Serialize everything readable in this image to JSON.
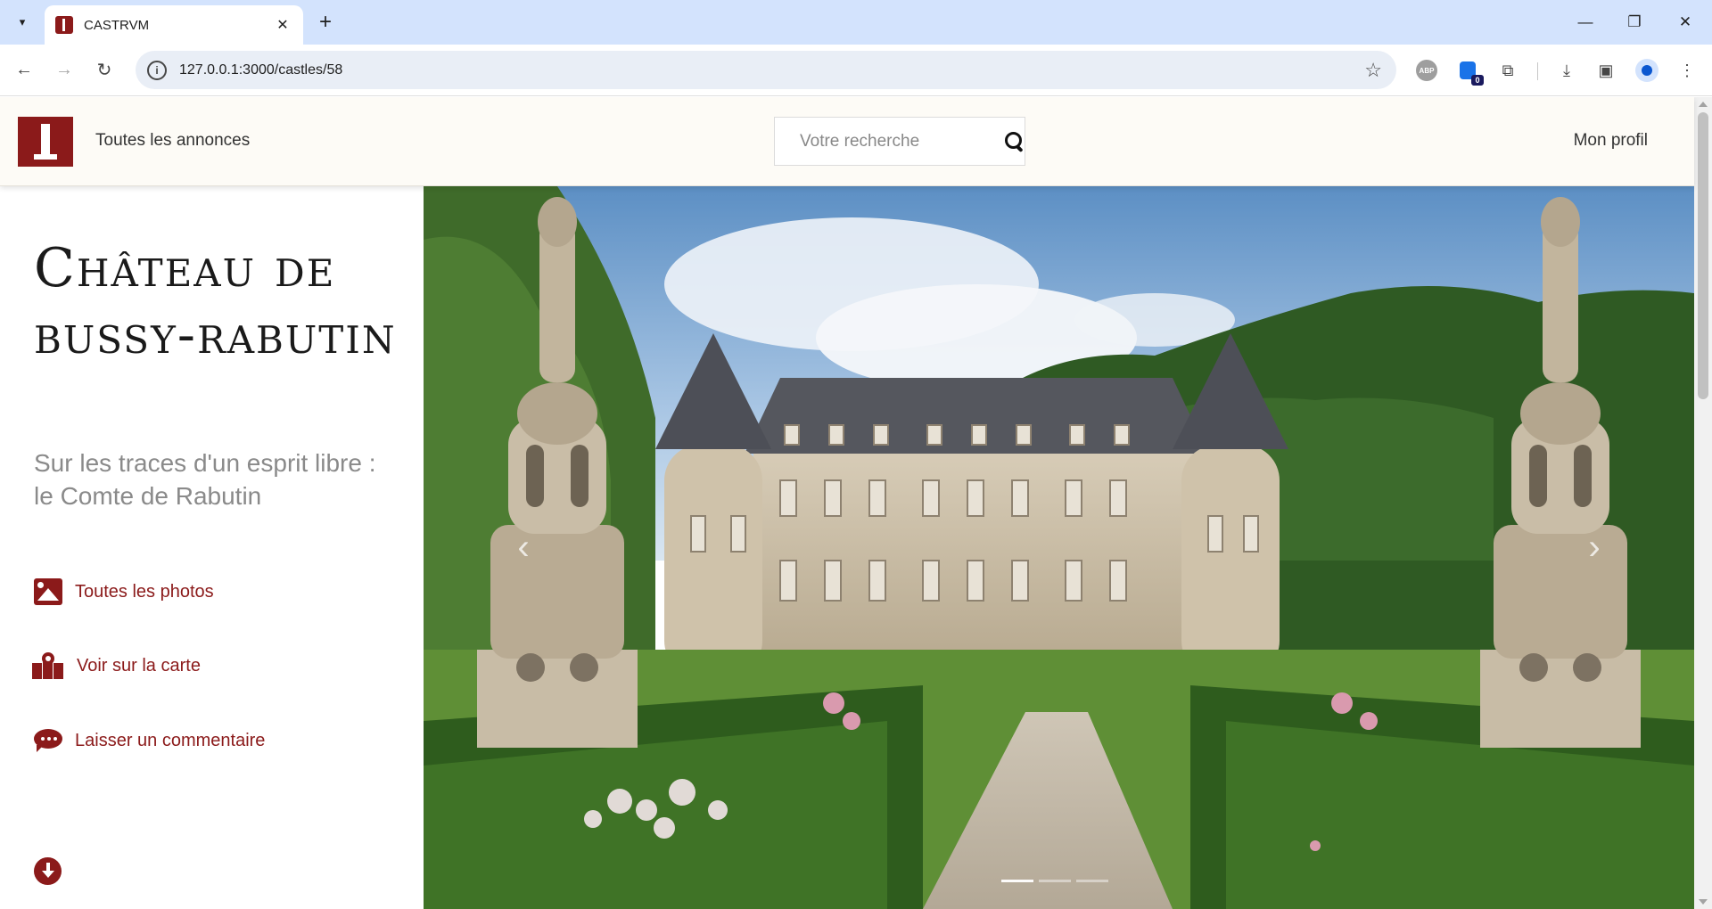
{
  "browser": {
    "tab_title": "CASTRVM",
    "url": "127.0.0.1:3000/castles/58",
    "extension_badge": "0",
    "abp_label": "ABP"
  },
  "header": {
    "nav_all": "Toutes les annonces",
    "search_placeholder": "Votre recherche",
    "nav_profile": "Mon profil"
  },
  "castle": {
    "title": "Château de bussy-rabutin",
    "subtitle": "Sur les traces d'un esprit libre : le Comte de Rabutin",
    "actions": [
      {
        "label": "Toutes les photos",
        "icon": "image-icon"
      },
      {
        "label": "Voir sur la carte",
        "icon": "map-location-icon"
      },
      {
        "label": "Laisser un commentaire",
        "icon": "comment-dots-icon"
      }
    ]
  },
  "carousel": {
    "slides": 3,
    "active_index": 0
  },
  "colors": {
    "brand": "#8b1a1a",
    "header_bg": "#fdfbf6",
    "subtitle": "#8a8a8a"
  }
}
